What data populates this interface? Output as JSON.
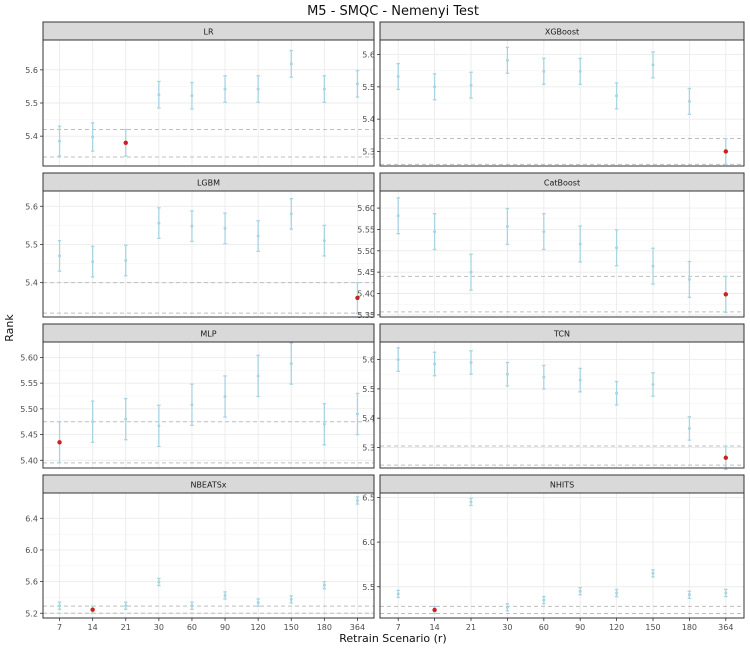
{
  "title": "M5 - SMQC - Nemenyi Test",
  "xlabel": "Retrain Scenario (r)",
  "ylabel": "Rank",
  "x_categories": [
    "7",
    "14",
    "21",
    "30",
    "60",
    "90",
    "120",
    "150",
    "180",
    "364"
  ],
  "colors": {
    "errorbar": "#a8d5e2",
    "highlight_point": "#cc1f1f",
    "strip_background": "#d9d9d9",
    "panel_border": "#333333",
    "grid": "#ebebeb",
    "reference_line": "#bfbfbf"
  },
  "chart_data": [
    {
      "type": "errorbar",
      "panel": "LR",
      "ylim": [
        5.31,
        5.69
      ],
      "yticks": [
        5.4,
        5.5,
        5.6
      ],
      "ytick_labels": [
        "5.4",
        "5.5",
        "5.6"
      ],
      "reference_lines": [
        5.337,
        5.42
      ],
      "highlight_index": 2,
      "values": [
        {
          "x": "7",
          "mean": 5.385,
          "lower": 5.34,
          "upper": 5.43
        },
        {
          "x": "14",
          "mean": 5.398,
          "lower": 5.355,
          "upper": 5.44
        },
        {
          "x": "21",
          "mean": 5.38,
          "lower": 5.34,
          "upper": 5.42
        },
        {
          "x": "30",
          "mean": 5.525,
          "lower": 5.485,
          "upper": 5.565
        },
        {
          "x": "60",
          "mean": 5.522,
          "lower": 5.482,
          "upper": 5.562
        },
        {
          "x": "90",
          "mean": 5.542,
          "lower": 5.502,
          "upper": 5.582
        },
        {
          "x": "120",
          "mean": 5.542,
          "lower": 5.502,
          "upper": 5.582
        },
        {
          "x": "150",
          "mean": 5.618,
          "lower": 5.578,
          "upper": 5.658
        },
        {
          "x": "180",
          "mean": 5.542,
          "lower": 5.502,
          "upper": 5.582
        },
        {
          "x": "364",
          "mean": 5.558,
          "lower": 5.518,
          "upper": 5.598
        }
      ]
    },
    {
      "type": "errorbar",
      "panel": "XGBoost",
      "ylim": [
        5.255,
        5.645
      ],
      "yticks": [
        5.3,
        5.4,
        5.5,
        5.6
      ],
      "ytick_labels": [
        "5.3",
        "5.4",
        "5.5",
        "5.6"
      ],
      "reference_lines": [
        5.26,
        5.34
      ],
      "highlight_index": 9,
      "values": [
        {
          "x": "7",
          "mean": 5.532,
          "lower": 5.492,
          "upper": 5.572
        },
        {
          "x": "14",
          "mean": 5.5,
          "lower": 5.46,
          "upper": 5.54
        },
        {
          "x": "21",
          "mean": 5.505,
          "lower": 5.465,
          "upper": 5.545
        },
        {
          "x": "30",
          "mean": 5.582,
          "lower": 5.542,
          "upper": 5.622
        },
        {
          "x": "60",
          "mean": 5.548,
          "lower": 5.508,
          "upper": 5.588
        },
        {
          "x": "90",
          "mean": 5.548,
          "lower": 5.508,
          "upper": 5.588
        },
        {
          "x": "120",
          "mean": 5.472,
          "lower": 5.432,
          "upper": 5.512
        },
        {
          "x": "150",
          "mean": 5.568,
          "lower": 5.528,
          "upper": 5.608
        },
        {
          "x": "180",
          "mean": 5.455,
          "lower": 5.415,
          "upper": 5.495
        },
        {
          "x": "364",
          "mean": 5.3,
          "lower": 5.26,
          "upper": 5.34
        }
      ]
    },
    {
      "type": "errorbar",
      "panel": "LGBM",
      "ylim": [
        5.31,
        5.64
      ],
      "yticks": [
        5.4,
        5.5,
        5.6
      ],
      "ytick_labels": [
        "5.4",
        "5.5",
        "5.6"
      ],
      "reference_lines": [
        5.32,
        5.4
      ],
      "highlight_index": 9,
      "values": [
        {
          "x": "7",
          "mean": 5.47,
          "lower": 5.43,
          "upper": 5.51
        },
        {
          "x": "14",
          "mean": 5.455,
          "lower": 5.415,
          "upper": 5.495
        },
        {
          "x": "21",
          "mean": 5.458,
          "lower": 5.418,
          "upper": 5.498
        },
        {
          "x": "30",
          "mean": 5.556,
          "lower": 5.516,
          "upper": 5.596
        },
        {
          "x": "60",
          "mean": 5.548,
          "lower": 5.508,
          "upper": 5.588
        },
        {
          "x": "90",
          "mean": 5.542,
          "lower": 5.502,
          "upper": 5.582
        },
        {
          "x": "120",
          "mean": 5.522,
          "lower": 5.482,
          "upper": 5.562
        },
        {
          "x": "150",
          "mean": 5.58,
          "lower": 5.54,
          "upper": 5.62
        },
        {
          "x": "180",
          "mean": 5.51,
          "lower": 5.47,
          "upper": 5.55
        },
        {
          "x": "364",
          "mean": 5.36,
          "lower": 5.32,
          "upper": 5.4
        }
      ]
    },
    {
      "type": "errorbar",
      "panel": "CatBoost",
      "ylim": [
        5.345,
        5.64
      ],
      "yticks": [
        5.35,
        5.4,
        5.45,
        5.5,
        5.55,
        5.6
      ],
      "ytick_labels": [
        "5.35",
        "5.40",
        "5.45",
        "5.50",
        "5.55",
        "5.60"
      ],
      "reference_lines": [
        5.357,
        5.44
      ],
      "highlight_index": 9,
      "values": [
        {
          "x": "7",
          "mean": 5.582,
          "lower": 5.54,
          "upper": 5.624
        },
        {
          "x": "14",
          "mean": 5.545,
          "lower": 5.503,
          "upper": 5.587
        },
        {
          "x": "21",
          "mean": 5.45,
          "lower": 5.408,
          "upper": 5.492
        },
        {
          "x": "30",
          "mean": 5.557,
          "lower": 5.515,
          "upper": 5.599
        },
        {
          "x": "60",
          "mean": 5.545,
          "lower": 5.503,
          "upper": 5.587
        },
        {
          "x": "90",
          "mean": 5.516,
          "lower": 5.474,
          "upper": 5.558
        },
        {
          "x": "120",
          "mean": 5.507,
          "lower": 5.465,
          "upper": 5.549
        },
        {
          "x": "150",
          "mean": 5.464,
          "lower": 5.422,
          "upper": 5.506
        },
        {
          "x": "180",
          "mean": 5.433,
          "lower": 5.391,
          "upper": 5.475
        },
        {
          "x": "364",
          "mean": 5.398,
          "lower": 5.356,
          "upper": 5.44
        }
      ]
    },
    {
      "type": "errorbar",
      "panel": "MLP",
      "ylim": [
        5.385,
        5.63
      ],
      "yticks": [
        5.4,
        5.45,
        5.5,
        5.55,
        5.6
      ],
      "ytick_labels": [
        "5.40",
        "5.45",
        "5.50",
        "5.55",
        "5.60"
      ],
      "reference_lines": [
        5.395,
        5.475
      ],
      "highlight_index": 0,
      "values": [
        {
          "x": "7",
          "mean": 5.435,
          "lower": 5.395,
          "upper": 5.475
        },
        {
          "x": "14",
          "mean": 5.475,
          "lower": 5.435,
          "upper": 5.515
        },
        {
          "x": "21",
          "mean": 5.48,
          "lower": 5.44,
          "upper": 5.52
        },
        {
          "x": "30",
          "mean": 5.467,
          "lower": 5.427,
          "upper": 5.507
        },
        {
          "x": "60",
          "mean": 5.508,
          "lower": 5.468,
          "upper": 5.548
        },
        {
          "x": "90",
          "mean": 5.524,
          "lower": 5.484,
          "upper": 5.564
        },
        {
          "x": "120",
          "mean": 5.564,
          "lower": 5.524,
          "upper": 5.604
        },
        {
          "x": "150",
          "mean": 5.588,
          "lower": 5.548,
          "upper": 5.628
        },
        {
          "x": "180",
          "mean": 5.47,
          "lower": 5.43,
          "upper": 5.51
        },
        {
          "x": "364",
          "mean": 5.49,
          "lower": 5.45,
          "upper": 5.53
        }
      ]
    },
    {
      "type": "errorbar",
      "panel": "TCN",
      "ylim": [
        5.23,
        5.66
      ],
      "yticks": [
        5.3,
        5.4,
        5.5,
        5.6
      ],
      "ytick_labels": [
        "5.3",
        "5.4",
        "5.5",
        "5.6"
      ],
      "reference_lines": [
        5.24,
        5.305
      ],
      "highlight_index": 9,
      "values": [
        {
          "x": "7",
          "mean": 5.6,
          "lower": 5.56,
          "upper": 5.64
        },
        {
          "x": "14",
          "mean": 5.585,
          "lower": 5.545,
          "upper": 5.625
        },
        {
          "x": "21",
          "mean": 5.59,
          "lower": 5.55,
          "upper": 5.63
        },
        {
          "x": "30",
          "mean": 5.55,
          "lower": 5.51,
          "upper": 5.59
        },
        {
          "x": "60",
          "mean": 5.54,
          "lower": 5.5,
          "upper": 5.58
        },
        {
          "x": "90",
          "mean": 5.53,
          "lower": 5.49,
          "upper": 5.57
        },
        {
          "x": "120",
          "mean": 5.485,
          "lower": 5.445,
          "upper": 5.525
        },
        {
          "x": "150",
          "mean": 5.515,
          "lower": 5.475,
          "upper": 5.555
        },
        {
          "x": "180",
          "mean": 5.365,
          "lower": 5.325,
          "upper": 5.405
        },
        {
          "x": "364",
          "mean": 5.265,
          "lower": 5.225,
          "upper": 5.305
        }
      ]
    },
    {
      "type": "errorbar",
      "panel": "NBEATSx",
      "ylim": [
        5.14,
        6.72
      ],
      "yticks": [
        5.2,
        5.6,
        6.0,
        6.4
      ],
      "ytick_labels": [
        "5.2",
        "5.6",
        "6.0",
        "6.4"
      ],
      "reference_lines": [
        5.2,
        5.29
      ],
      "highlight_index": 1,
      "values": [
        {
          "x": "7",
          "mean": 5.295,
          "lower": 5.25,
          "upper": 5.34
        },
        {
          "x": "14",
          "mean": 5.245,
          "lower": 5.2,
          "upper": 5.29
        },
        {
          "x": "21",
          "mean": 5.295,
          "lower": 5.25,
          "upper": 5.34
        },
        {
          "x": "30",
          "mean": 5.595,
          "lower": 5.55,
          "upper": 5.64
        },
        {
          "x": "60",
          "mean": 5.295,
          "lower": 5.25,
          "upper": 5.34
        },
        {
          "x": "90",
          "mean": 5.425,
          "lower": 5.38,
          "upper": 5.47
        },
        {
          "x": "120",
          "mean": 5.335,
          "lower": 5.29,
          "upper": 5.38
        },
        {
          "x": "150",
          "mean": 5.375,
          "lower": 5.33,
          "upper": 5.42
        },
        {
          "x": "180",
          "mean": 5.555,
          "lower": 5.51,
          "upper": 5.6
        },
        {
          "x": "364",
          "mean": 6.625,
          "lower": 6.58,
          "upper": 6.67
        }
      ]
    },
    {
      "type": "errorbar",
      "panel": "NHITS",
      "ylim": [
        5.15,
        6.55
      ],
      "yticks": [
        5.5,
        6.0,
        6.5
      ],
      "ytick_labels": [
        "5.5",
        "6.0",
        "6.5"
      ],
      "reference_lines": [
        5.2,
        5.28
      ],
      "highlight_index": 1,
      "values": [
        {
          "x": "7",
          "mean": 5.42,
          "lower": 5.38,
          "upper": 5.46
        },
        {
          "x": "14",
          "mean": 5.24,
          "lower": 5.2,
          "upper": 5.28
        },
        {
          "x": "21",
          "mean": 6.45,
          "lower": 6.41,
          "upper": 6.49
        },
        {
          "x": "30",
          "mean": 5.27,
          "lower": 5.23,
          "upper": 5.31
        },
        {
          "x": "60",
          "mean": 5.35,
          "lower": 5.31,
          "upper": 5.39
        },
        {
          "x": "90",
          "mean": 5.45,
          "lower": 5.41,
          "upper": 5.49
        },
        {
          "x": "120",
          "mean": 5.43,
          "lower": 5.39,
          "upper": 5.47
        },
        {
          "x": "150",
          "mean": 5.65,
          "lower": 5.61,
          "upper": 5.69
        },
        {
          "x": "180",
          "mean": 5.41,
          "lower": 5.37,
          "upper": 5.45
        },
        {
          "x": "364",
          "mean": 5.43,
          "lower": 5.39,
          "upper": 5.47
        }
      ]
    }
  ]
}
